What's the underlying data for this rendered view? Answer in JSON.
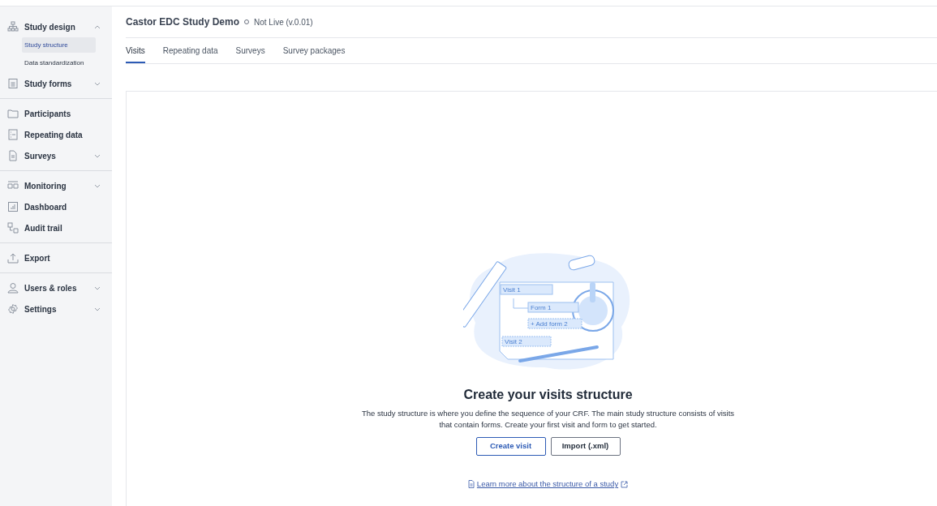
{
  "sidebar": {
    "sections": [
      {
        "items": [
          {
            "label": "Study design",
            "expanded": true,
            "children": [
              {
                "label": "Study structure",
                "selected": true
              },
              {
                "label": "Data standardization",
                "selected": false
              }
            ]
          },
          {
            "label": "Study forms",
            "expanded": false
          }
        ]
      },
      {
        "items": [
          {
            "label": "Participants"
          },
          {
            "label": "Repeating data"
          },
          {
            "label": "Surveys",
            "expanded": false
          }
        ]
      },
      {
        "items": [
          {
            "label": "Monitoring",
            "expanded": false
          },
          {
            "label": "Dashboard"
          },
          {
            "label": "Audit trail"
          }
        ]
      },
      {
        "items": [
          {
            "label": "Export"
          }
        ]
      },
      {
        "items": [
          {
            "label": "Users & roles",
            "expanded": false
          },
          {
            "label": "Settings",
            "expanded": false
          }
        ]
      }
    ]
  },
  "header": {
    "title": "Castor EDC Study Demo",
    "status": "Not Live (v.0.01)"
  },
  "tabs": [
    {
      "label": "Visits",
      "selected": true
    },
    {
      "label": "Repeating data",
      "selected": false
    },
    {
      "label": "Surveys",
      "selected": false
    },
    {
      "label": "Survey packages",
      "selected": false
    }
  ],
  "empty_state": {
    "illustration_labels": [
      "Visit 1",
      "Form 1",
      "+ Add form 2",
      "Visit 2"
    ],
    "title": "Create your visits structure",
    "description": "The study structure is where you define the sequence of your CRF. The main study structure consists of visits that contain forms. Create your first visit and form to get started.",
    "buttons": [
      {
        "label": "Create visit",
        "kind": "primary"
      },
      {
        "label": "Import (.xml)",
        "kind": "secondary"
      }
    ],
    "link": "Learn more about the structure of a study"
  }
}
